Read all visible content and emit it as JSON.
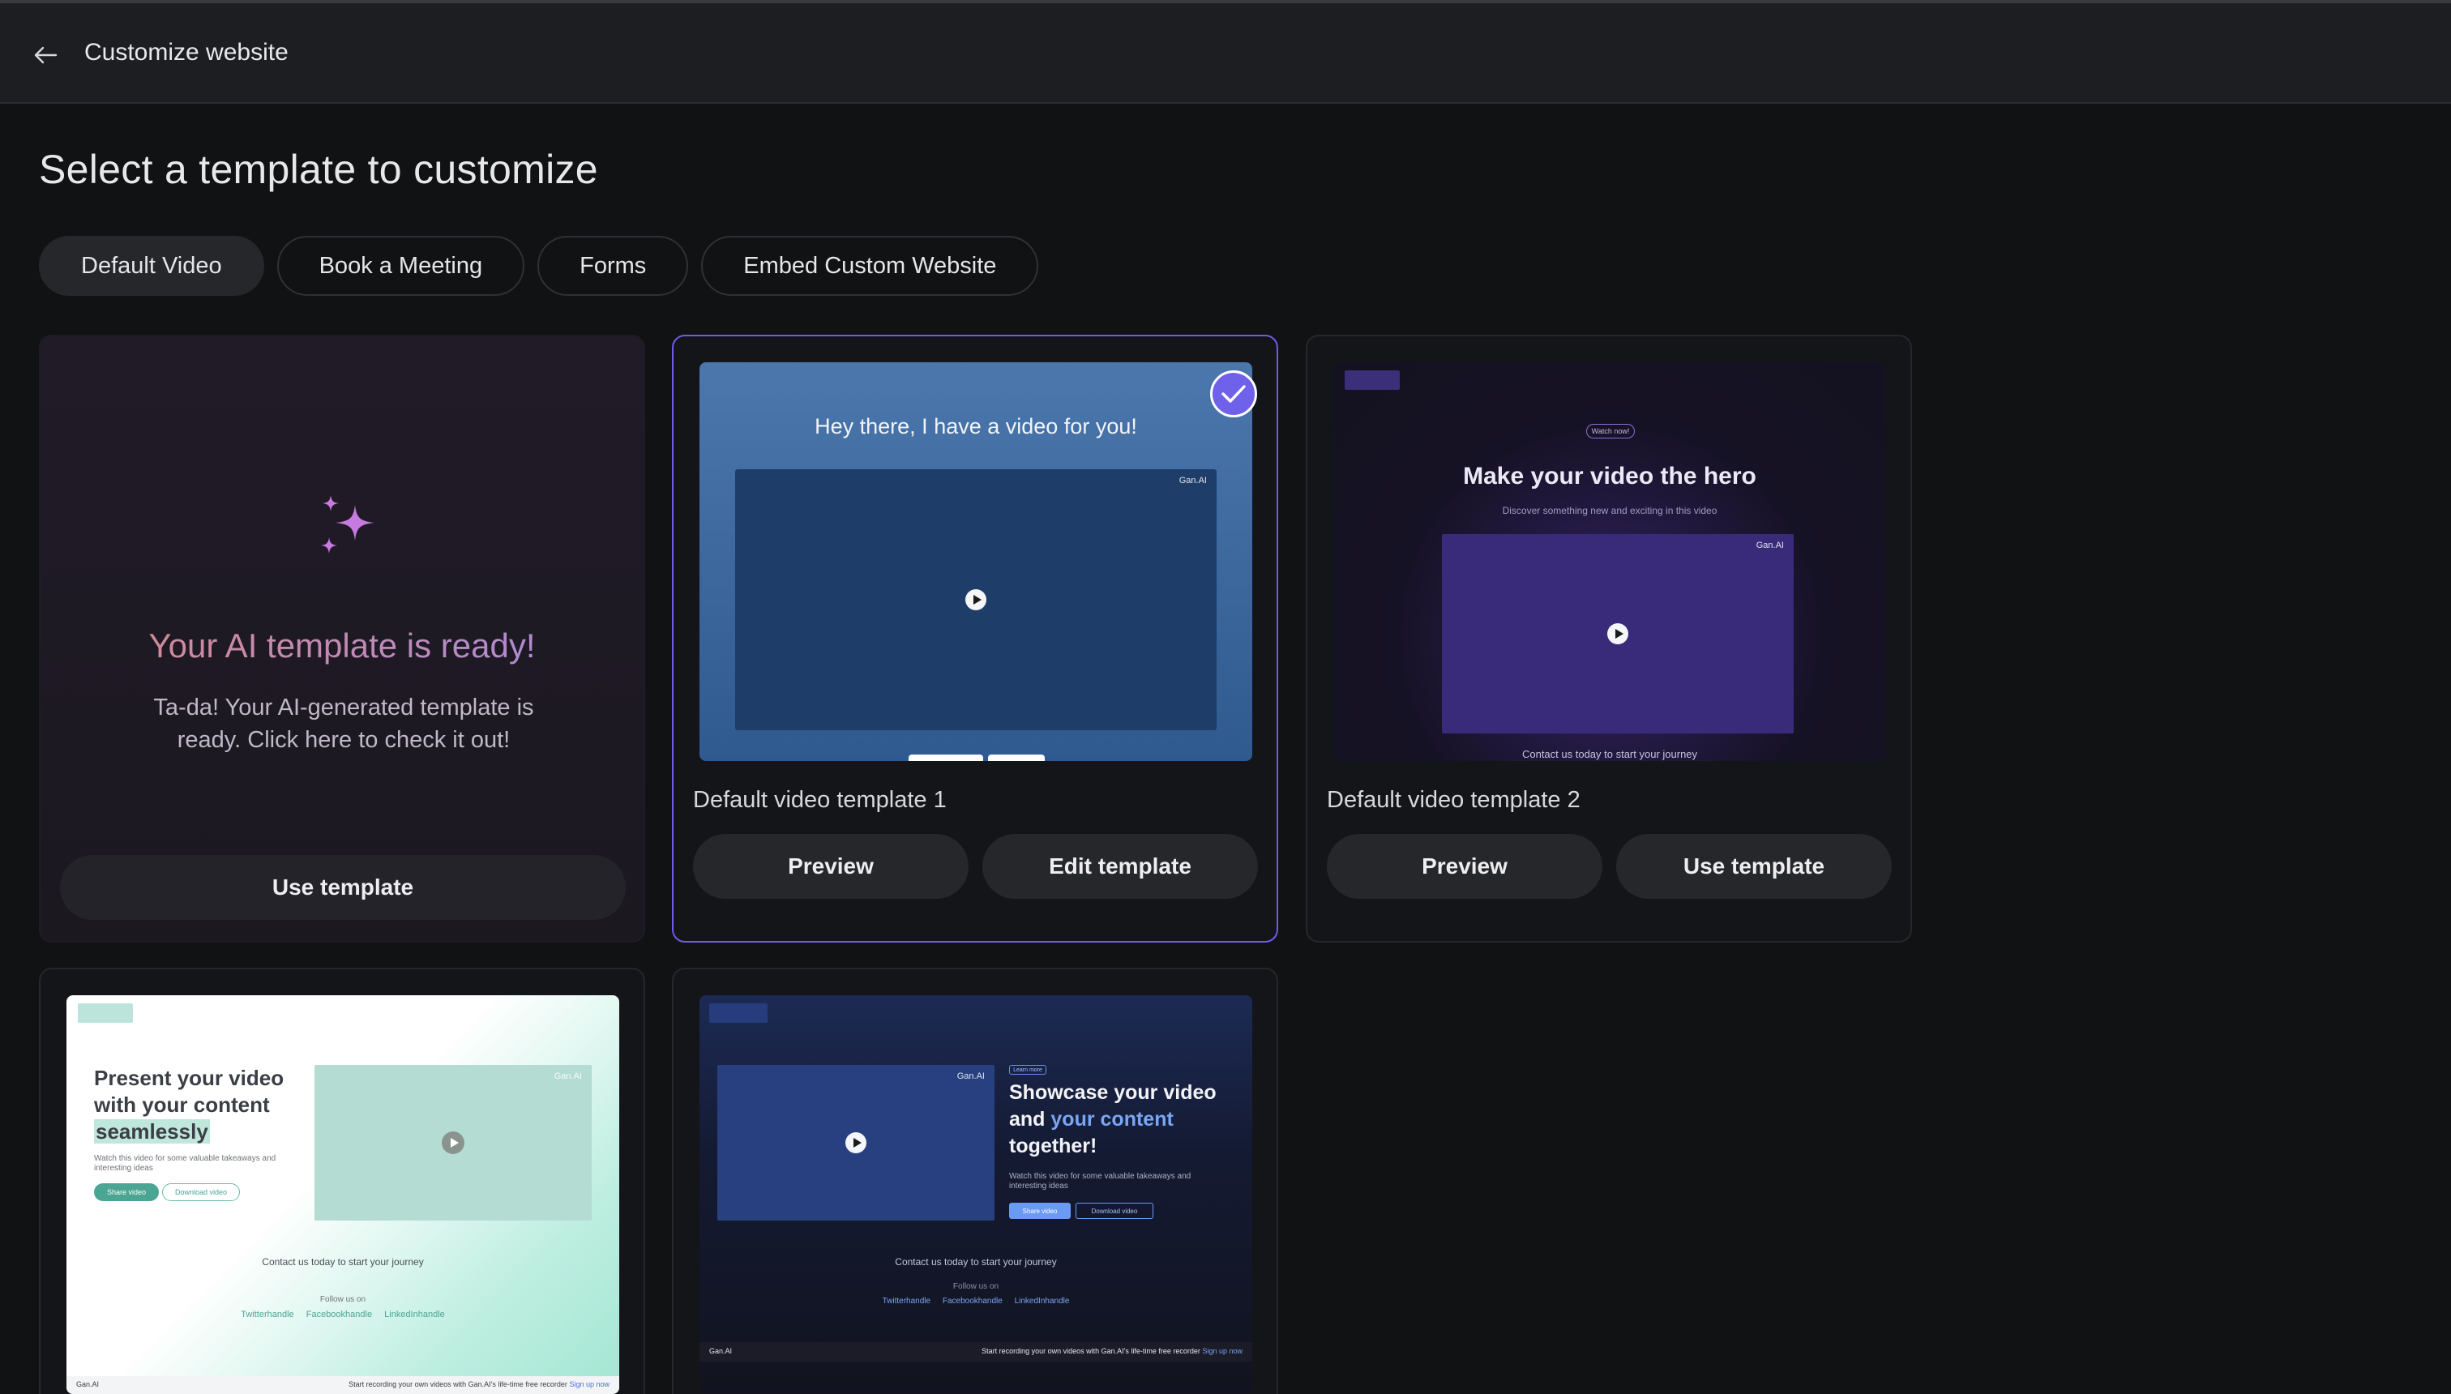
{
  "header": {
    "title": "Customize website"
  },
  "page": {
    "title": "Select a template to customize"
  },
  "tabs": [
    {
      "label": "Default Video",
      "active": true
    },
    {
      "label": "Book a Meeting",
      "active": false
    },
    {
      "label": "Forms",
      "active": false
    },
    {
      "label": "Embed Custom Website",
      "active": false
    }
  ],
  "ai_card": {
    "title": "Your AI template is ready!",
    "description": "Ta-da! Your AI-generated template is ready. Click here to check it out!",
    "button": "Use template",
    "icon": "sparkle-icon"
  },
  "templates": [
    {
      "label": "Default video template 1",
      "selected": true,
      "buttons": [
        "Preview",
        "Edit template"
      ],
      "preview": {
        "heading": "Hey there, I have a video for you!",
        "brand": "Gan.AI"
      }
    },
    {
      "label": "Default video template 2",
      "selected": false,
      "buttons": [
        "Preview",
        "Use template"
      ],
      "preview": {
        "pill": "Watch now!",
        "heading": "Make your video the hero",
        "subheading": "Discover something new and exciting in this video",
        "brand": "Gan.AI",
        "footer": "Contact us today to start your journey"
      }
    },
    {
      "label": "",
      "selected": false,
      "preview": {
        "heading_line1": "Present your video",
        "heading_line2": "with your content",
        "heading_highlight": "seamlessly",
        "subheading": "Watch this video for some valuable takeaways and interesting ideas",
        "share_btn": "Share video",
        "download_btn": "Download video",
        "brand": "Gan.AI",
        "contact": "Contact us today to start your journey",
        "follow": "Follow us on",
        "socials": [
          "Twitterhandle",
          "Facebookhandle",
          "LinkedInhandle"
        ],
        "bar_brand": "Gan.AI",
        "bar_text": "Start recording your own videos with Gan.AI's life-time free recorder",
        "bar_cta": "Sign up now"
      }
    },
    {
      "label": "",
      "selected": false,
      "preview": {
        "pill": "Learn more",
        "heading_line1": "Showcase your video",
        "heading_and": "and",
        "heading_blue": "your content",
        "heading_line3": "together!",
        "subheading": "Watch this video for some valuable takeaways and interesting ideas",
        "share_btn": "Share video",
        "download_btn": "Download video",
        "brand": "Gan.AI",
        "contact": "Contact us today to start your journey",
        "follow": "Follow us on",
        "socials": [
          "Twitterhandle",
          "Facebookhandle",
          "LinkedInhandle"
        ],
        "bar_brand": "Gan.AI",
        "bar_text": "Start recording your own videos with Gan.AI's life-time free recorder",
        "bar_cta": "Sign up now"
      }
    }
  ],
  "colors": {
    "accent": "#6d5ce8",
    "background": "#111214",
    "ai_gradient_start": "#d98a8a",
    "ai_gradient_end": "#a88be0"
  }
}
